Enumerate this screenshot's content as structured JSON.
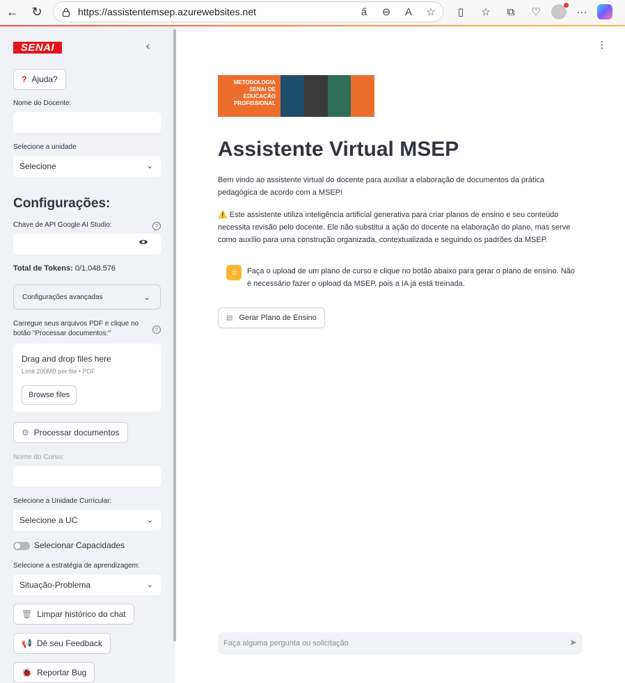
{
  "browser": {
    "url": "https://assistentemsep.azurewebsites.net"
  },
  "sidebar": {
    "logo_text": "SENAI",
    "help_button": "Ajuda?",
    "docente_label": "Nome do Docente:",
    "unidade_label": "Selecione a unidade",
    "unidade_value": "Selecione",
    "config_heading": "Configurações:",
    "api_key_label": "Chave de API Google AI Studio:",
    "tokens_label": "Total de Tokens:",
    "tokens_value": " 0/1.048.576",
    "advanced_label": "Configurações avançadas",
    "upload_label": "Carregue seus arquivos PDF e clique no botão \"Processar documentos:\"",
    "uploader": {
      "title": "Drag and drop files here",
      "limit": "Limit 200MB per file • PDF",
      "browse": "Browse files"
    },
    "process_button": "Processar documentos",
    "curso_label": "Nome do Curso:",
    "uc_label": "Selecione a Unidade Curricular:",
    "uc_value": "Selecione a UC",
    "capacidades_label": "Selecionar Capacidades",
    "estrategia_label": "Selecione a estratégia de aprendizagem:",
    "estrategia_value": "Situação-Problema",
    "clear_button": "Limpar histórico do chat",
    "feedback_button": "Dê seu Feedback",
    "bug_button": "Reportar Bug"
  },
  "main": {
    "banner_text": "METODOLOGIA SENAI DE EDUCAÇÃO PROFISSIONAL",
    "title": "Assistente Virtual MSEP",
    "intro": "Bem vindo ao assistente virtual do docente para auxiliar a elaboração de documentos da prática pedagógica de acordo com a MSEP!",
    "warning": "⚠️ Este assistente utiliza inteligência artificial generativa para criar planos de ensino e seu conteúdo necessita revisão pelo docente. Ele não substitui a ação do docente na elaboração do plano, mas serve como auxílio para uma construção organizada, contextualizada e seguindo os padrões da MSEP.",
    "info": "Faça o upload de um plano de curso e clique no botão abaixo para gerar o plano de ensino. Não é necessário fazer o upload da MSEP, pois a IA já está treinada.",
    "generate_button": "Gerar Plano de Ensino",
    "chat_placeholder": "Faça alguma pergunta ou solicitação"
  },
  "colors": {
    "accent": "#e3151a",
    "banner_orange": "#ed6d2c",
    "info_badge": "#fdb62f"
  }
}
